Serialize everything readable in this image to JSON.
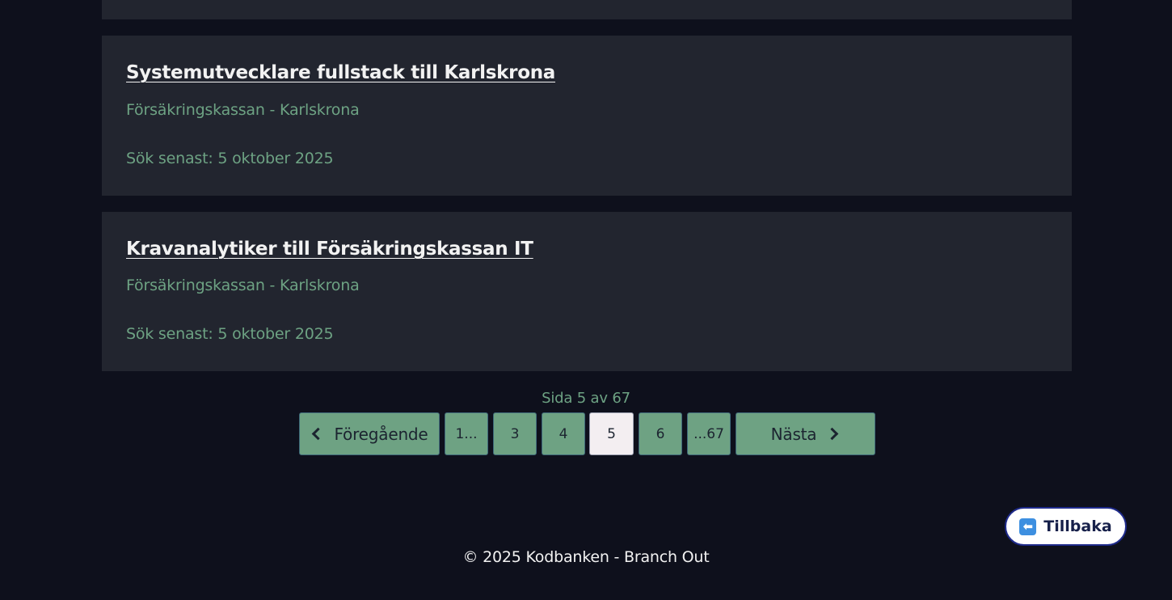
{
  "jobs": [
    {
      "title": "Systemutvecklare fullstack till Karlskrona",
      "employer_location": "Försäkringskassan - Karlskrona",
      "deadline": "Sök senast: 5 oktober 2025"
    },
    {
      "title": "Kravanalytiker till Försäkringskassan IT",
      "employer_location": "Försäkringskassan - Karlskrona",
      "deadline": "Sök senast: 5 oktober 2025"
    }
  ],
  "pagination": {
    "info": "Sida 5 av 67",
    "current_page": 5,
    "total_pages": 67,
    "prev_label": "Föregående",
    "next_label": "Nästa",
    "pages": [
      "1...",
      "3",
      "4",
      "5",
      "6",
      "...67"
    ]
  },
  "back_button": {
    "label": "Tillbaka",
    "icon": "left-arrow-icon"
  },
  "footer": {
    "text": "© 2025 Kodbanken - Branch Out"
  },
  "colors": {
    "background": "#0e101c",
    "card": "#22252f",
    "accent_green": "#6da283",
    "active_page": "#f3eef1"
  }
}
